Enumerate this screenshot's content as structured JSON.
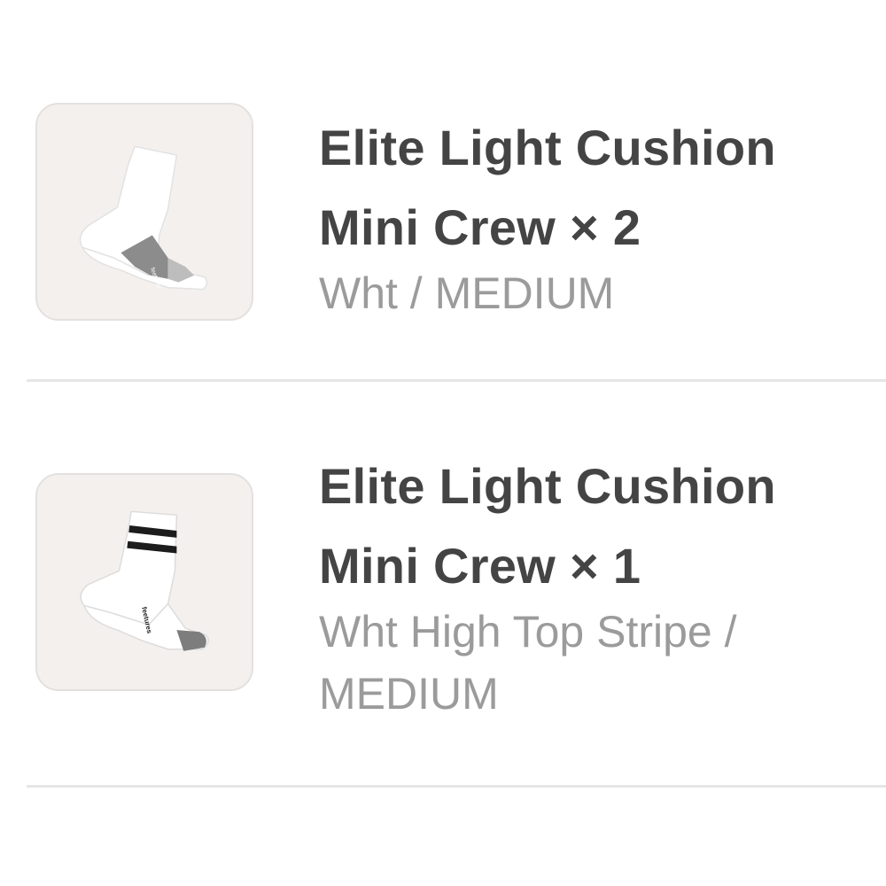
{
  "items": [
    {
      "name": "Elite Light Cushion Mini Crew",
      "quantity_text": "× 2",
      "line1": "Elite Light Cushion",
      "line2": "Mini Crew × 2",
      "variant": "Wht / MEDIUM",
      "image_icon": "white-sock-image"
    },
    {
      "name": "Elite Light Cushion Mini Crew",
      "quantity_text": "× 1",
      "line1": "Elite Light Cushion",
      "line2": "Mini Crew × 1",
      "variant": "Wht High Top Stripe / MEDIUM",
      "image_icon": "striped-sock-image"
    }
  ],
  "colors": {
    "title": "#444444",
    "variant": "#9b9b9b",
    "thumb_bg": "#f4f0ee",
    "divider": "#e6e6e6"
  }
}
